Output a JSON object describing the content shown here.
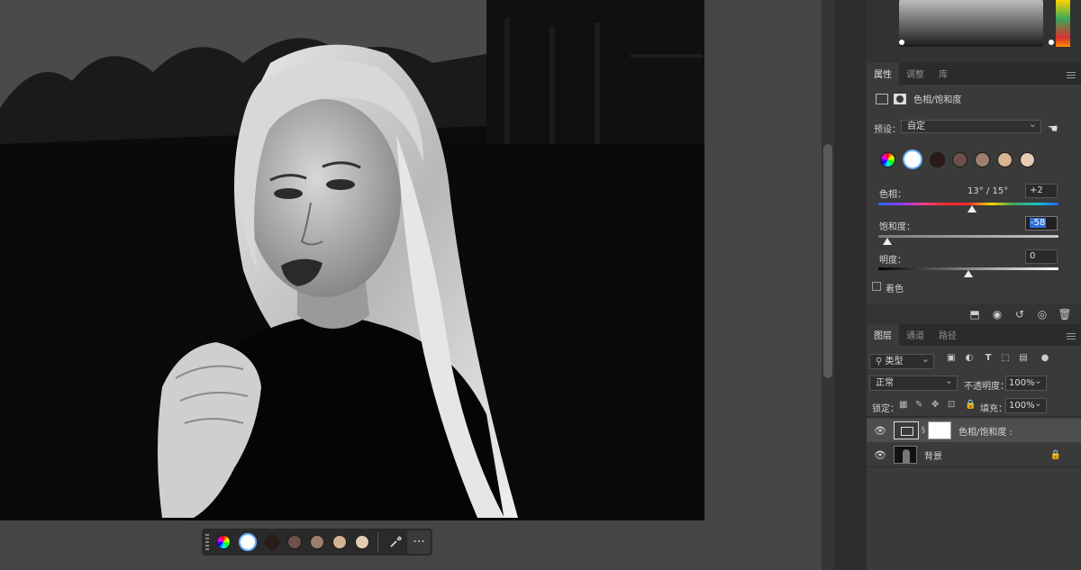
{
  "floating_bar": {
    "more_label": "···",
    "eyedropper_icon": "eyedropper-icon",
    "swatches": [
      "#2b1b18",
      "#6b5149",
      "#9c7f6d",
      "#d2b394",
      "#e4ccb1"
    ]
  },
  "properties": {
    "tabs": [
      "属性",
      "调整",
      "库"
    ],
    "title": "色相/饱和度",
    "preset_label": "预设：",
    "preset_value": "自定",
    "swatches": [
      "#2b1b18",
      "#6b5149",
      "#9c7f6d",
      "#d8b493",
      "#e6cdb2"
    ],
    "hue": {
      "label": "色相：",
      "range": "13° / 15°",
      "value": "+2",
      "position": 0.52
    },
    "saturation": {
      "label": "饱和度：",
      "value": "-58",
      "position": 0.05
    },
    "lightness": {
      "label": "明度：",
      "value": "0",
      "position": 0.5
    },
    "colorize_label": "着色"
  },
  "layers": {
    "tabs": [
      "图层",
      "通道",
      "路径"
    ],
    "filter_value": "类型",
    "blend_mode": "正常",
    "opacity_label": "不透明度：",
    "opacity_value": "100%",
    "lock_label": "锁定：",
    "fill_label": "填充：",
    "fill_value": "100%",
    "items": [
      {
        "name": "色相/饱和度 :",
        "selected": true
      },
      {
        "name": "背景",
        "selected": false
      }
    ]
  },
  "colors": {
    "accent": "#6ab0ff",
    "highlight": "#2f6fd6"
  }
}
